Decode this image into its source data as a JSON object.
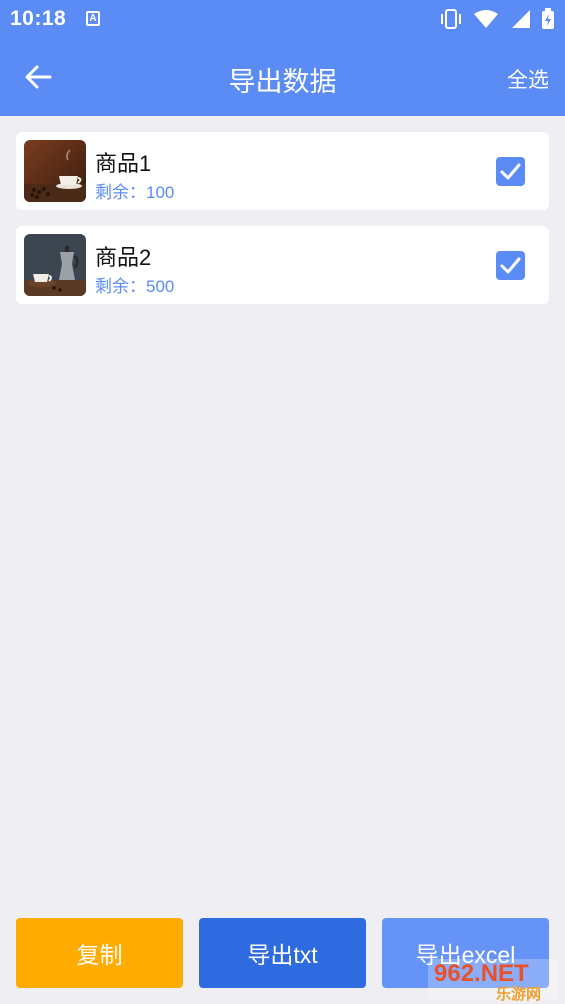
{
  "status": {
    "time": "10:18"
  },
  "header": {
    "title": "导出数据",
    "select_all": "全选"
  },
  "items": [
    {
      "name": "商品1",
      "stock": "剩余：100",
      "checked": true
    },
    {
      "name": "商品2",
      "stock": "剩余：500",
      "checked": true
    }
  ],
  "actions": {
    "copy": "复制",
    "export_txt": "导出txt",
    "export_excel": "导出excel"
  },
  "watermark": {
    "brand": "962.NET",
    "sub": "乐游网"
  },
  "colors": {
    "primary": "#5b8cf5",
    "copy": "#ffab00",
    "export_txt": "#2f6be0",
    "export_excel": "#6693f7",
    "background": "#efeff3"
  },
  "icons": {
    "back": "arrow-left-icon",
    "check": "checkbox-checked-icon"
  }
}
